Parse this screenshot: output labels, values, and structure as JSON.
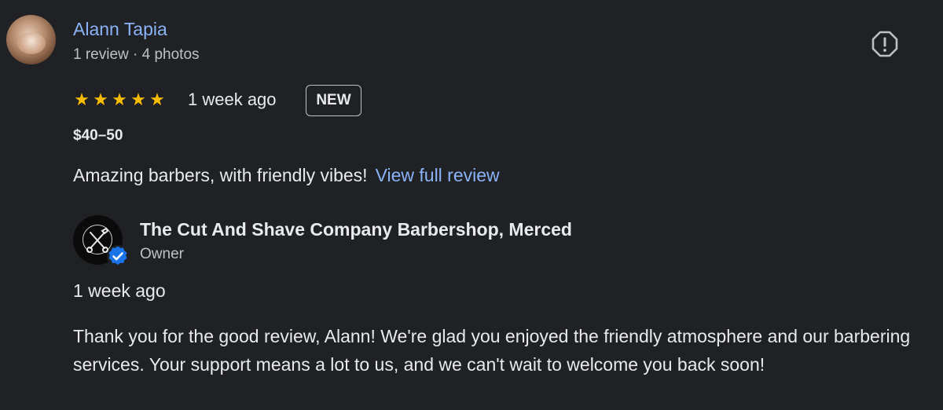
{
  "review": {
    "reviewer_name": "Alann Tapia",
    "reviewer_meta": "1 review · 4 photos",
    "rating_stars": 5,
    "star_glyph": "★",
    "date": "1 week ago",
    "badge": "NEW",
    "price": "$40–50",
    "text": "Amazing barbers, with friendly vibes!",
    "view_full_label": "View full review",
    "report_icon": "report-icon"
  },
  "owner_reply": {
    "business_name": "The Cut And Shave Company Barbershop, Merced",
    "role": "Owner",
    "date": "1 week ago",
    "text": "Thank you for the good review, Alann! We're glad you enjoyed the friendly atmosphere and our barbering services. Your support means a lot to us, and we can't wait to welcome you back soon!",
    "verified_icon": "verified-badge-icon"
  },
  "colors": {
    "background": "#202124",
    "link": "#8ab4f8",
    "star": "#fbbc04",
    "primary_text": "#e8eaed",
    "secondary_text": "#bdc1c6",
    "verified": "#1a73e8"
  }
}
